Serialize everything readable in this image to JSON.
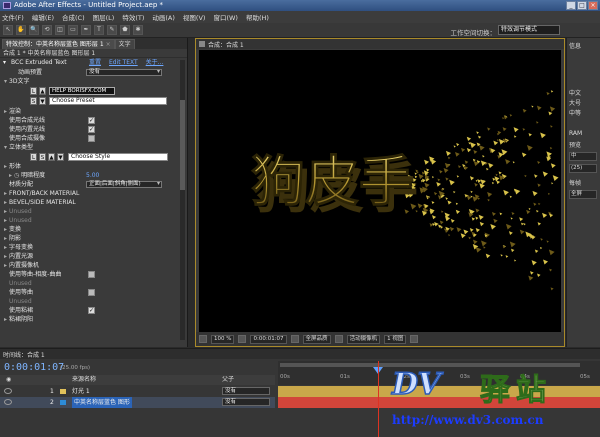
{
  "window": {
    "title": "Adobe After Effects - Untitled Project.aep *"
  },
  "window_buttons": [
    "_",
    "□",
    "×"
  ],
  "menu": [
    "文件(F)",
    "编辑(E)",
    "合成(C)",
    "图层(L)",
    "特效(T)",
    "动画(A)",
    "视图(V)",
    "窗口(W)",
    "帮助(H)"
  ],
  "toolbar": {
    "tools": [
      "↖",
      "✋",
      "🔍",
      "⟲",
      "◫",
      "▭",
      "✒",
      "T",
      "✎",
      "⬟",
      "✱"
    ],
    "workspace_label": "工作空间切换：",
    "workspace_value": "特效调节模式"
  },
  "effect_panel": {
    "tabs": [
      {
        "label": "特效控制：中英名称层蓝色 图形层 1",
        "active": true
      },
      {
        "label": "文字",
        "active": false
      }
    ],
    "comp_line": "合成 1 * 中英名称层蓝色 图形层 1",
    "effect_name": "BCC Extruded Text",
    "links": [
      "重置",
      "Edit TEXT",
      "关于..."
    ],
    "animation_preset_label": "动画预置",
    "animation_preset_value": "没有",
    "section_3d": "3D文字",
    "help_box": "HELP  BORISFX.COM",
    "preset_input": "Choose Preset",
    "rows1": [
      {
        "label": "渲染",
        "checked": null
      },
      {
        "label": "使用合成光线",
        "checked": true
      },
      {
        "label": "使用内置光线",
        "checked": true
      },
      {
        "label": "使用合成摄像",
        "checked": false
      }
    ],
    "section_style": "立体类型",
    "style_input": "Choose Style",
    "shape_label": "形体",
    "rotation_label": "明暗程度",
    "rotation_value": "5.00",
    "material_label": "材质分配",
    "material_value": "正面|后面|斜角|侧面)",
    "rows2": [
      {
        "label": "FRONT/BACK MATERIAL",
        "dim": false
      },
      {
        "label": "BEVEL/SIDE MATERIAL",
        "dim": false
      },
      {
        "label": "Unused",
        "dim": true
      },
      {
        "label": "Unused",
        "dim": true
      },
      {
        "label": "变换",
        "dim": false
      },
      {
        "label": "阴影",
        "dim": false
      },
      {
        "label": "字母变换",
        "dim": false
      },
      {
        "label": "内置光源",
        "dim": false
      },
      {
        "label": "内置摄像机",
        "dim": false
      }
    ],
    "bottom_rows": [
      {
        "label": "使用等曲-相度-曲曲",
        "checked": false,
        "dim": false
      },
      {
        "label": "Unused",
        "checked": null,
        "dim": true
      },
      {
        "label": "使用等曲",
        "checked": false,
        "dim": false
      },
      {
        "label": "Unused",
        "checked": null,
        "dim": true
      },
      {
        "label": "使用粘裙",
        "checked": true,
        "dim": false
      },
      {
        "label": "粘裙阴阳",
        "checked": null,
        "dim": false
      }
    ]
  },
  "viewer": {
    "tab": "合成：合成 1",
    "zoom": "100 %",
    "timecode": "0:00:01:07",
    "quality": "全屏品质",
    "camera": "活动摄像机",
    "views": "1 视图",
    "stage_text": "狗皮手",
    "text_color_main": "#d8c24a",
    "text_color_shade": "#6d5a18"
  },
  "right_panel": {
    "labels": [
      "信息",
      "中文",
      "大号",
      "中等",
      "RAM",
      "预览",
      "每帧"
    ],
    "boxes": [
      "中",
      "(25)",
      "全屏"
    ]
  },
  "timeline": {
    "tab": "时间线：合成 1",
    "time": "0:00:01:07",
    "fps": "(25.00 fps)",
    "header_source": "来源名称",
    "header_parent": "父子",
    "layers": [
      {
        "num": "1",
        "name": "灯光 1",
        "color": "#e0c15a",
        "parent": "没有",
        "bar_color": "#c9a74a"
      },
      {
        "num": "2",
        "name": "中英名称层蓝色 图形",
        "color": "#2d8cd8",
        "parent": "没有",
        "bar_color": "#d2453a"
      }
    ],
    "ruler_ticks": [
      "00s",
      "01s",
      "02s",
      "03s",
      "04s",
      "05s"
    ]
  },
  "watermark": {
    "dv": "DV",
    "cn": "驿站",
    "url": "http://www.dv3.com.cn"
  }
}
